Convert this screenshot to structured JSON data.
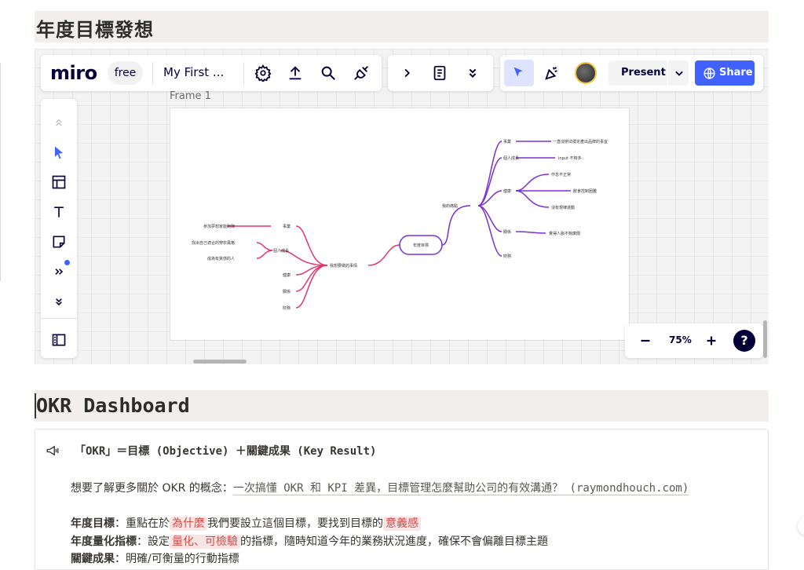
{
  "headings": {
    "h1": "年度目標發想",
    "h2": "OKR Dashboard"
  },
  "miro": {
    "logo": "miro",
    "plan": "free",
    "board_name": "My First ...",
    "frame_label": "Frame 1",
    "present_label": "Present",
    "share_label": "Share",
    "zoom": "75%",
    "help": "?",
    "icons": [
      "settings-icon",
      "upload-icon",
      "search-icon",
      "plug-icon",
      "chevron-right-icon",
      "notes-icon",
      "chevron-double-down-icon",
      "select-cursor-icon",
      "celebrate-icon",
      "avatar",
      "globe-icon",
      "collapse-up-icon",
      "pointer-icon",
      "template-icon",
      "text-icon",
      "sticky-note-icon",
      "more-tools-icon",
      "expand-down-icon",
      "board-panel-icon",
      "minus-icon",
      "plus-icon"
    ],
    "accent": "#4262ff",
    "mindmap": {
      "root": "年度目標",
      "left_branch": "我想要做的事情",
      "left_children": [
        "事業",
        "個人成長",
        "健康",
        "關係",
        "財務"
      ],
      "left_leaves": [
        "參加夢想家能跑陣",
        "找出自己適合的穿衣風格",
        "成為有質感的人"
      ],
      "right_branch": "我的痛點",
      "right_children": [
        "事業",
        "個人成長",
        "健康",
        "關係",
        "財務"
      ],
      "right_leaves": [
        "一直沒辦法穩定產出品牌的事宜",
        "input 不夠多",
        "作息不正常",
        "飲食控制困難",
        "沒有規律運動",
        "覺得人脈不夠廣闊"
      ],
      "left_color": "#e8336d",
      "right_color": "#7b2fd6"
    }
  },
  "callout": {
    "icon": "megaphone-icon",
    "title": "「OKR」＝目標 (Objective) ＋關鍵成果 (Key Result)",
    "line1_prefix": "想要了解更多關於 OKR 的概念：",
    "line1_link": "一次搞懂 OKR 和 KPI 差異，目標管理怎麼幫助公司的有效溝通？ (raymondhouch.com)",
    "line2_label": "年度目標",
    "line2_a": "：重點在於",
    "line2_hl1": "為什麼",
    "line2_b": "我們要設立這個目標，要找到目標的",
    "line2_hl2": "意義感",
    "line3_label": "年度量化指標",
    "line3_a": "：設定",
    "line3_hl1": "量化、可檢驗",
    "line3_b": "的指標，隨時知道今年的業務狀況進度，確保不會偏離目標主題",
    "line4_label": "關鍵成果",
    "line4_a": "：明確/可衡量的行動指標"
  }
}
